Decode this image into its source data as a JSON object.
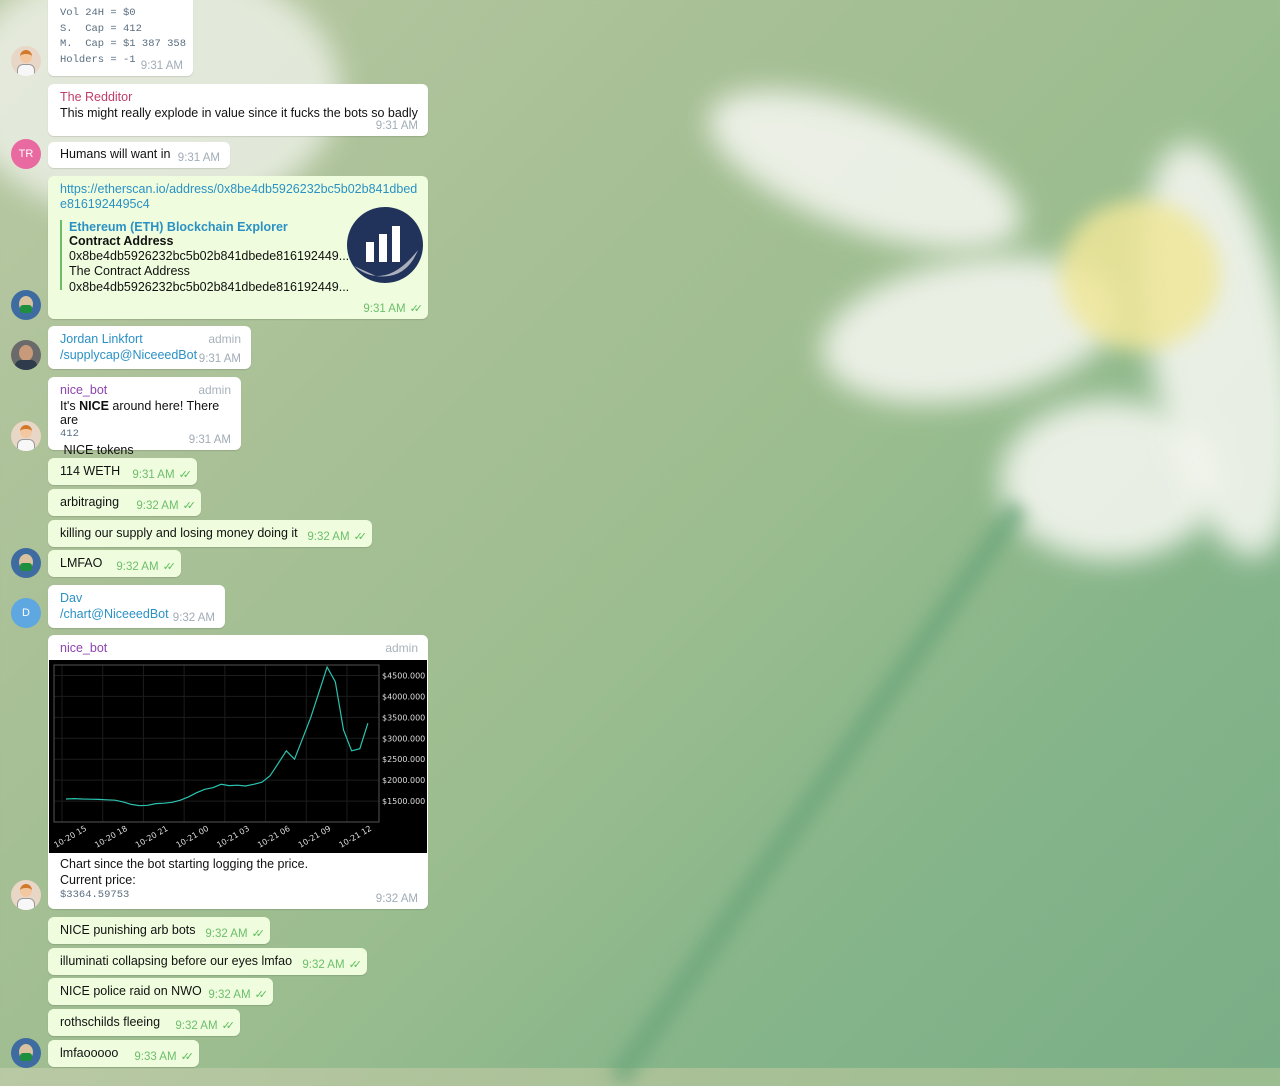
{
  "messages": {
    "m1": {
      "lines": [
        "Vol 24H = $0",
        "S.  Cap = 412",
        "M.  Cap = $1 387 358",
        "Holders = -1"
      ],
      "time": "9:31 AM"
    },
    "m2": {
      "sender": "The Redditor",
      "sender_color": "#c03d6a",
      "text": "This might really explode in value since it fucks the bots so badly",
      "time": "9:31 AM"
    },
    "m3": {
      "avatar_initials": "TR",
      "avatar_color": "#e86aa0",
      "text": "Humans will want in",
      "time": "9:31 AM"
    },
    "m4": {
      "link": "https://etherscan.io/address/0x8be4db5926232bc5b02b841dbede8161924495c4",
      "preview": {
        "site": "Ethereum (ETH) Blockchain Explorer",
        "title": "Contract Address",
        "title2": "0x8be4db5926232bc5b02b841dbede816192449...",
        "desc": "The Contract Address",
        "desc2": "0x8be4db5926232bc5b02b841dbede816192449..."
      },
      "time": "9:31 AM"
    },
    "m5": {
      "sender": "Jordan Linkfort",
      "role": "admin",
      "text": "/supplycap@NiceeedBot",
      "time": "9:31 AM"
    },
    "m6": {
      "sender": "nice_bot",
      "role": "admin",
      "text_pre": "It's ",
      "text_bold": "NICE",
      "text_post": " around here! There are",
      "count": "412",
      "suffix": " NICE tokens",
      "time": "9:31 AM"
    },
    "m7": {
      "text": "114 WETH",
      "time": "9:31 AM"
    },
    "m8": {
      "text": "arbitraging",
      "time": "9:32 AM"
    },
    "m9": {
      "text": "killing our supply and losing money doing it",
      "time": "9:32 AM"
    },
    "m10": {
      "text": "LMFAO",
      "time": "9:32 AM"
    },
    "m11": {
      "avatar_initials": "D",
      "avatar_color": "#5ea7e0",
      "sender": "Dav",
      "text": "/chart@NiceeedBot",
      "time": "9:32 AM"
    },
    "m12": {
      "sender": "nice_bot",
      "role": "admin",
      "caption1": "Chart since the bot starting logging the price.",
      "caption2": "Current price:",
      "price": "$3364.59753",
      "time": "9:32 AM"
    },
    "m13": {
      "text": "NICE punishing arb bots",
      "time": "9:32 AM"
    },
    "m14": {
      "text": "illuminati collapsing before our eyes lmfao",
      "time": "9:32 AM"
    },
    "m15": {
      "text": "NICE police raid on NWO",
      "time": "9:32 AM"
    },
    "m16": {
      "text": "rothschilds fleeing",
      "time": "9:32 AM"
    },
    "m17": {
      "text": "lmfaooooo",
      "time": "9:33 AM"
    }
  },
  "colors": {
    "link": "#2b91c5",
    "admin_name_bot": "#8e44ad",
    "admin_name_user": "#2b91c5",
    "outgoing_bubble": "#effdde",
    "chart_line": "#2bc4b0"
  },
  "chart_data": {
    "type": "line",
    "x": [
      "10-20 15",
      "10-20 18",
      "10-20 21",
      "10-21 00",
      "10-21 03",
      "10-21 06",
      "10-21 09",
      "10-21 12"
    ],
    "y_ticks": [
      "$1500.000",
      "$2000.000",
      "$2500.000",
      "$3000.000",
      "$3500.000",
      "$4000.000",
      "$4500.000"
    ],
    "ylim": [
      1000,
      4750
    ],
    "series": [
      {
        "values": [
          1550,
          1560,
          1550,
          1545,
          1540,
          1530,
          1520,
          1480,
          1420,
          1390,
          1400,
          1440,
          1450,
          1470,
          1520,
          1600,
          1700,
          1780,
          1820,
          1900,
          1870,
          1880,
          1860,
          1900,
          1950,
          2100,
          2400,
          2700,
          2500,
          3000,
          3500,
          4100,
          4700,
          4350,
          3200,
          2700,
          2750,
          3360
        ]
      }
    ],
    "grid": true
  }
}
